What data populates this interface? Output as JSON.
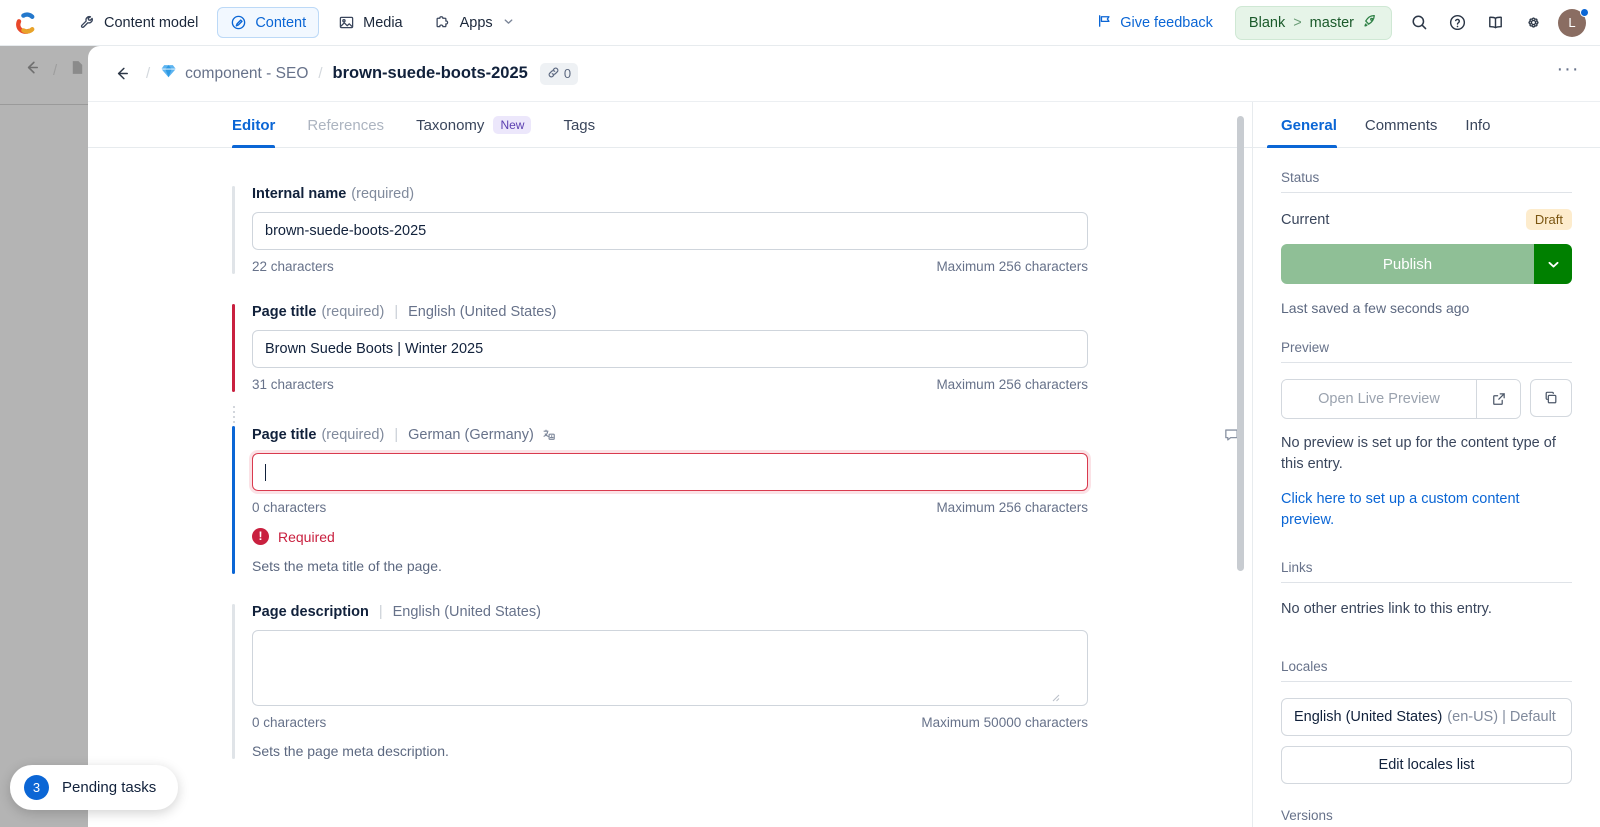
{
  "topnav": {
    "logo_name": "contentful-logo",
    "items": [
      {
        "label": "Content model",
        "icon": "wrench-icon",
        "active": false
      },
      {
        "label": "Content",
        "icon": "content-pen-icon",
        "active": true
      },
      {
        "label": "Media",
        "icon": "image-icon",
        "active": false
      },
      {
        "label": "Apps",
        "icon": "puzzle-icon",
        "active": false,
        "has_caret": true
      }
    ],
    "give_feedback": "Give feedback",
    "environment": {
      "space": "Blank",
      "separator": ">",
      "env": "master",
      "icon": "rocket-icon"
    },
    "icons": [
      "search-icon",
      "help-circle-icon",
      "book-icon",
      "gear-icon"
    ],
    "avatar_initial": "L"
  },
  "breadcrumb": {
    "back_icon": "arrow-left-icon",
    "type_icon": "diamond-icon",
    "content_type": "component - SEO",
    "entry_title": "brown-suede-boots-2025",
    "links_count": "0",
    "links_icon": "link-icon",
    "more_label": "···"
  },
  "editor": {
    "tabs": [
      {
        "label": "Editor",
        "active": true,
        "disabled": false,
        "badge": ""
      },
      {
        "label": "References",
        "active": false,
        "disabled": true,
        "badge": ""
      },
      {
        "label": "Taxonomy",
        "active": false,
        "disabled": false,
        "badge": "New"
      },
      {
        "label": "Tags",
        "active": false,
        "disabled": false,
        "badge": ""
      }
    ],
    "fields": [
      {
        "name": "internal-name",
        "label": "Internal name",
        "required_text": "(required)",
        "locale": "",
        "value": "brown-suede-boots-2025",
        "char_count": "22 characters",
        "max_text": "Maximum 256 characters",
        "error": "",
        "help": "",
        "state": "plain"
      },
      {
        "name": "page-title-en-us",
        "label": "Page title",
        "required_text": "(required)",
        "locale": "English (United States)",
        "value": "Brown Suede Boots | Winter 2025",
        "char_count": "31 characters",
        "max_text": "Maximum 256 characters",
        "error": "",
        "help": "",
        "state": "err"
      },
      {
        "name": "page-title-de-de",
        "label": "Page title",
        "required_text": "(required)",
        "locale": "German (Germany)",
        "value": "",
        "char_count": "0 characters",
        "max_text": "Maximum 256 characters",
        "error": "Required",
        "help": "Sets the meta title of the page.",
        "state": "focus"
      },
      {
        "name": "page-description-en-us",
        "label": "Page description",
        "required_text": "",
        "locale": "English (United States)",
        "value": "",
        "char_count": "0 characters",
        "max_text": "Maximum 50000 characters",
        "error": "",
        "help": "Sets the page meta description.",
        "state": "plain"
      }
    ]
  },
  "sidebar": {
    "tabs": [
      {
        "label": "General",
        "active": true
      },
      {
        "label": "Comments",
        "active": false
      },
      {
        "label": "Info",
        "active": false
      }
    ],
    "status": {
      "section": "Status",
      "current_label": "Current",
      "badge": "Draft",
      "publish_label": "Publish",
      "publish_color": "#8fbf96",
      "publish_caret_color": "#008000",
      "last_saved": "Last saved a few seconds ago"
    },
    "preview": {
      "section": "Preview",
      "button_label": "Open Live Preview",
      "external_icon": "external-link-icon",
      "copy_icon": "copy-icon",
      "note": "No preview is set up for the content type of this entry.",
      "link": "Click here to set up a custom content preview."
    },
    "links": {
      "section": "Links",
      "note": "No other entries link to this entry."
    },
    "locales": {
      "section": "Locales",
      "selected": "English (United States)",
      "selected_meta": "(en-US) | Default",
      "edit_label": "Edit locales list"
    },
    "versions": {
      "section": "Versions"
    }
  },
  "pending_tasks": {
    "count": "3",
    "label": "Pending tasks"
  },
  "colors": {
    "accent_blue": "#0b66d5",
    "error_red": "#c9203f",
    "draft_amber": "#fdeccd",
    "env_green": "#e6f4e8"
  }
}
